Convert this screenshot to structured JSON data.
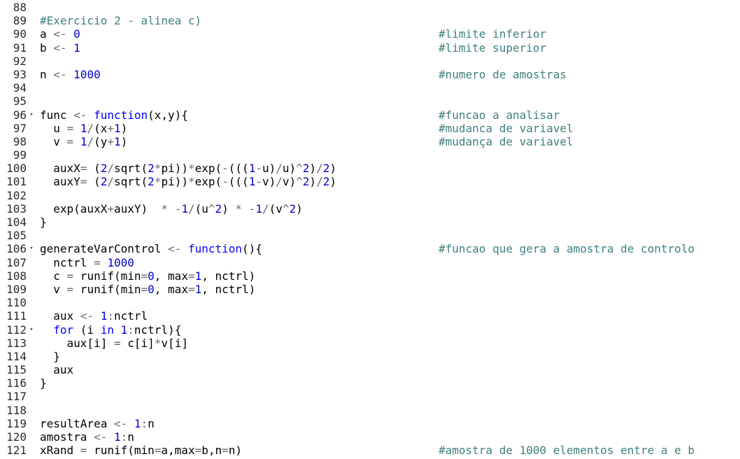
{
  "editor": {
    "colors": {
      "comment": "#3f7f7f",
      "number": "#0000cd",
      "keyword": "#0000ff",
      "operator": "#6b6b6b",
      "text": "#000000",
      "gutter": "#2b2b2b"
    },
    "fold_icon": "fold-triangle-icon",
    "fold_glyph": "▾",
    "lines": [
      {
        "n": "88",
        "fold": false,
        "tokens": [],
        "comment": ""
      },
      {
        "n": "89",
        "fold": false,
        "tokens": [
          {
            "t": "#Exercicio 2 - alinea c)",
            "k": "cm"
          }
        ],
        "comment": ""
      },
      {
        "n": "90",
        "fold": false,
        "tokens": [
          {
            "t": "a ",
            "k": "id"
          },
          {
            "t": "<-",
            "k": "op"
          },
          {
            "t": " ",
            "k": "id"
          },
          {
            "t": "0",
            "k": "num"
          }
        ],
        "comment": "#limite inferior"
      },
      {
        "n": "91",
        "fold": false,
        "tokens": [
          {
            "t": "b ",
            "k": "id"
          },
          {
            "t": "<-",
            "k": "op"
          },
          {
            "t": " ",
            "k": "id"
          },
          {
            "t": "1",
            "k": "num"
          }
        ],
        "comment": "#limite superior"
      },
      {
        "n": "92",
        "fold": false,
        "tokens": [],
        "comment": ""
      },
      {
        "n": "93",
        "fold": false,
        "tokens": [
          {
            "t": "n ",
            "k": "id"
          },
          {
            "t": "<-",
            "k": "op"
          },
          {
            "t": " ",
            "k": "id"
          },
          {
            "t": "1000",
            "k": "num"
          }
        ],
        "comment": "#numero de amostras"
      },
      {
        "n": "94",
        "fold": false,
        "tokens": [],
        "comment": ""
      },
      {
        "n": "95",
        "fold": false,
        "tokens": [],
        "comment": ""
      },
      {
        "n": "96",
        "fold": true,
        "tokens": [
          {
            "t": "func ",
            "k": "id"
          },
          {
            "t": "<-",
            "k": "op"
          },
          {
            "t": " ",
            "k": "id"
          },
          {
            "t": "function",
            "k": "kw"
          },
          {
            "t": "(x,y){",
            "k": "id"
          }
        ],
        "comment": "#funcao a analisar"
      },
      {
        "n": "97",
        "fold": false,
        "tokens": [
          {
            "t": "  u ",
            "k": "id"
          },
          {
            "t": "=",
            "k": "op"
          },
          {
            "t": " ",
            "k": "id"
          },
          {
            "t": "1",
            "k": "num"
          },
          {
            "t": "/",
            "k": "op"
          },
          {
            "t": "(x",
            "k": "id"
          },
          {
            "t": "+",
            "k": "op"
          },
          {
            "t": "1",
            "k": "num"
          },
          {
            "t": ")",
            "k": "id"
          }
        ],
        "comment": "#mudanca de variavel"
      },
      {
        "n": "98",
        "fold": false,
        "tokens": [
          {
            "t": "  v ",
            "k": "id"
          },
          {
            "t": "=",
            "k": "op"
          },
          {
            "t": " ",
            "k": "id"
          },
          {
            "t": "1",
            "k": "num"
          },
          {
            "t": "/",
            "k": "op"
          },
          {
            "t": "(y",
            "k": "id"
          },
          {
            "t": "+",
            "k": "op"
          },
          {
            "t": "1",
            "k": "num"
          },
          {
            "t": ")",
            "k": "id"
          }
        ],
        "comment": "#mudança de variavel"
      },
      {
        "n": "99",
        "fold": false,
        "tokens": [],
        "comment": ""
      },
      {
        "n": "100",
        "fold": false,
        "tokens": [
          {
            "t": "  auxX",
            "k": "id"
          },
          {
            "t": "=",
            "k": "op"
          },
          {
            "t": " (",
            "k": "id"
          },
          {
            "t": "2",
            "k": "num"
          },
          {
            "t": "/",
            "k": "op"
          },
          {
            "t": "sqrt(",
            "k": "id"
          },
          {
            "t": "2",
            "k": "num"
          },
          {
            "t": "*",
            "k": "op"
          },
          {
            "t": "pi))",
            "k": "id"
          },
          {
            "t": "*",
            "k": "op"
          },
          {
            "t": "exp(",
            "k": "id"
          },
          {
            "t": "-",
            "k": "op"
          },
          {
            "t": "(((",
            "k": "id"
          },
          {
            "t": "1",
            "k": "num"
          },
          {
            "t": "-",
            "k": "op"
          },
          {
            "t": "u)",
            "k": "id"
          },
          {
            "t": "/",
            "k": "op"
          },
          {
            "t": "u)",
            "k": "id"
          },
          {
            "t": "^",
            "k": "op"
          },
          {
            "t": "2",
            "k": "num"
          },
          {
            "t": ")",
            "k": "id"
          },
          {
            "t": "/",
            "k": "op"
          },
          {
            "t": "2",
            "k": "num"
          },
          {
            "t": ")",
            "k": "id"
          }
        ],
        "comment": ""
      },
      {
        "n": "101",
        "fold": false,
        "tokens": [
          {
            "t": "  auxY",
            "k": "id"
          },
          {
            "t": "=",
            "k": "op"
          },
          {
            "t": " (",
            "k": "id"
          },
          {
            "t": "2",
            "k": "num"
          },
          {
            "t": "/",
            "k": "op"
          },
          {
            "t": "sqrt(",
            "k": "id"
          },
          {
            "t": "2",
            "k": "num"
          },
          {
            "t": "*",
            "k": "op"
          },
          {
            "t": "pi))",
            "k": "id"
          },
          {
            "t": "*",
            "k": "op"
          },
          {
            "t": "exp(",
            "k": "id"
          },
          {
            "t": "-",
            "k": "op"
          },
          {
            "t": "(((",
            "k": "id"
          },
          {
            "t": "1",
            "k": "num"
          },
          {
            "t": "-",
            "k": "op"
          },
          {
            "t": "v)",
            "k": "id"
          },
          {
            "t": "/",
            "k": "op"
          },
          {
            "t": "v)",
            "k": "id"
          },
          {
            "t": "^",
            "k": "op"
          },
          {
            "t": "2",
            "k": "num"
          },
          {
            "t": ")",
            "k": "id"
          },
          {
            "t": "/",
            "k": "op"
          },
          {
            "t": "2",
            "k": "num"
          },
          {
            "t": ")",
            "k": "id"
          }
        ],
        "comment": ""
      },
      {
        "n": "102",
        "fold": false,
        "tokens": [],
        "comment": ""
      },
      {
        "n": "103",
        "fold": false,
        "tokens": [
          {
            "t": "  exp(auxX",
            "k": "id"
          },
          {
            "t": "+",
            "k": "op"
          },
          {
            "t": "auxY)  ",
            "k": "id"
          },
          {
            "t": "*",
            "k": "op"
          },
          {
            "t": " ",
            "k": "id"
          },
          {
            "t": "-",
            "k": "op"
          },
          {
            "t": "1",
            "k": "num"
          },
          {
            "t": "/",
            "k": "op"
          },
          {
            "t": "(u",
            "k": "id"
          },
          {
            "t": "^",
            "k": "op"
          },
          {
            "t": "2",
            "k": "num"
          },
          {
            "t": ") ",
            "k": "id"
          },
          {
            "t": "*",
            "k": "op"
          },
          {
            "t": " ",
            "k": "id"
          },
          {
            "t": "-",
            "k": "op"
          },
          {
            "t": "1",
            "k": "num"
          },
          {
            "t": "/",
            "k": "op"
          },
          {
            "t": "(v",
            "k": "id"
          },
          {
            "t": "^",
            "k": "op"
          },
          {
            "t": "2",
            "k": "num"
          },
          {
            "t": ")",
            "k": "id"
          }
        ],
        "comment": ""
      },
      {
        "n": "104",
        "fold": false,
        "tokens": [
          {
            "t": "}",
            "k": "id"
          }
        ],
        "comment": ""
      },
      {
        "n": "105",
        "fold": false,
        "tokens": [],
        "comment": ""
      },
      {
        "n": "106",
        "fold": true,
        "tokens": [
          {
            "t": "generateVarControl ",
            "k": "id"
          },
          {
            "t": "<-",
            "k": "op"
          },
          {
            "t": " ",
            "k": "id"
          },
          {
            "t": "function",
            "k": "kw"
          },
          {
            "t": "(){",
            "k": "id"
          }
        ],
        "comment": "#funcao que gera a amostra de controlo"
      },
      {
        "n": "107",
        "fold": false,
        "tokens": [
          {
            "t": "  nctrl ",
            "k": "id"
          },
          {
            "t": "=",
            "k": "op"
          },
          {
            "t": " ",
            "k": "id"
          },
          {
            "t": "1000",
            "k": "num"
          }
        ],
        "comment": ""
      },
      {
        "n": "108",
        "fold": false,
        "tokens": [
          {
            "t": "  c ",
            "k": "id"
          },
          {
            "t": "=",
            "k": "op"
          },
          {
            "t": " runif(min",
            "k": "id"
          },
          {
            "t": "=",
            "k": "op"
          },
          {
            "t": "0",
            "k": "num"
          },
          {
            "t": ", max",
            "k": "id"
          },
          {
            "t": "=",
            "k": "op"
          },
          {
            "t": "1",
            "k": "num"
          },
          {
            "t": ", nctrl)",
            "k": "id"
          }
        ],
        "comment": ""
      },
      {
        "n": "109",
        "fold": false,
        "tokens": [
          {
            "t": "  v ",
            "k": "id"
          },
          {
            "t": "=",
            "k": "op"
          },
          {
            "t": " runif(min",
            "k": "id"
          },
          {
            "t": "=",
            "k": "op"
          },
          {
            "t": "0",
            "k": "num"
          },
          {
            "t": ", max",
            "k": "id"
          },
          {
            "t": "=",
            "k": "op"
          },
          {
            "t": "1",
            "k": "num"
          },
          {
            "t": ", nctrl)",
            "k": "id"
          }
        ],
        "comment": ""
      },
      {
        "n": "110",
        "fold": false,
        "tokens": [],
        "comment": ""
      },
      {
        "n": "111",
        "fold": false,
        "tokens": [
          {
            "t": "  aux ",
            "k": "id"
          },
          {
            "t": "<-",
            "k": "op"
          },
          {
            "t": " ",
            "k": "id"
          },
          {
            "t": "1",
            "k": "num"
          },
          {
            "t": ":",
            "k": "op"
          },
          {
            "t": "nctrl",
            "k": "id"
          }
        ],
        "comment": ""
      },
      {
        "n": "112",
        "fold": true,
        "tokens": [
          {
            "t": "  ",
            "k": "id"
          },
          {
            "t": "for",
            "k": "kw"
          },
          {
            "t": " (i ",
            "k": "id"
          },
          {
            "t": "in",
            "k": "kw"
          },
          {
            "t": " ",
            "k": "id"
          },
          {
            "t": "1",
            "k": "num"
          },
          {
            "t": ":",
            "k": "op"
          },
          {
            "t": "nctrl){",
            "k": "id"
          }
        ],
        "comment": ""
      },
      {
        "n": "113",
        "fold": false,
        "tokens": [
          {
            "t": "    aux[i] ",
            "k": "id"
          },
          {
            "t": "=",
            "k": "op"
          },
          {
            "t": " c[i]",
            "k": "id"
          },
          {
            "t": "*",
            "k": "op"
          },
          {
            "t": "v[i]",
            "k": "id"
          }
        ],
        "comment": ""
      },
      {
        "n": "114",
        "fold": false,
        "tokens": [
          {
            "t": "  }",
            "k": "id"
          }
        ],
        "comment": ""
      },
      {
        "n": "115",
        "fold": false,
        "tokens": [
          {
            "t": "  aux",
            "k": "id"
          }
        ],
        "comment": ""
      },
      {
        "n": "116",
        "fold": false,
        "tokens": [
          {
            "t": "}",
            "k": "id"
          }
        ],
        "comment": ""
      },
      {
        "n": "117",
        "fold": false,
        "tokens": [],
        "comment": ""
      },
      {
        "n": "118",
        "fold": false,
        "tokens": [],
        "comment": ""
      },
      {
        "n": "119",
        "fold": false,
        "tokens": [
          {
            "t": "resultArea ",
            "k": "id"
          },
          {
            "t": "<-",
            "k": "op"
          },
          {
            "t": " ",
            "k": "id"
          },
          {
            "t": "1",
            "k": "num"
          },
          {
            "t": ":",
            "k": "op"
          },
          {
            "t": "n",
            "k": "id"
          }
        ],
        "comment": ""
      },
      {
        "n": "120",
        "fold": false,
        "tokens": [
          {
            "t": "amostra ",
            "k": "id"
          },
          {
            "t": "<-",
            "k": "op"
          },
          {
            "t": " ",
            "k": "id"
          },
          {
            "t": "1",
            "k": "num"
          },
          {
            "t": ":",
            "k": "op"
          },
          {
            "t": "n",
            "k": "id"
          }
        ],
        "comment": ""
      },
      {
        "n": "121",
        "fold": false,
        "tokens": [
          {
            "t": "xRand ",
            "k": "id"
          },
          {
            "t": "=",
            "k": "op"
          },
          {
            "t": " runif(min",
            "k": "id"
          },
          {
            "t": "=",
            "k": "op"
          },
          {
            "t": "a,max",
            "k": "id"
          },
          {
            "t": "=",
            "k": "op"
          },
          {
            "t": "b,n",
            "k": "id"
          },
          {
            "t": "=",
            "k": "op"
          },
          {
            "t": "n)",
            "k": "id"
          }
        ],
        "comment": "#amostra de 1000 elementos entre a e b"
      }
    ]
  }
}
